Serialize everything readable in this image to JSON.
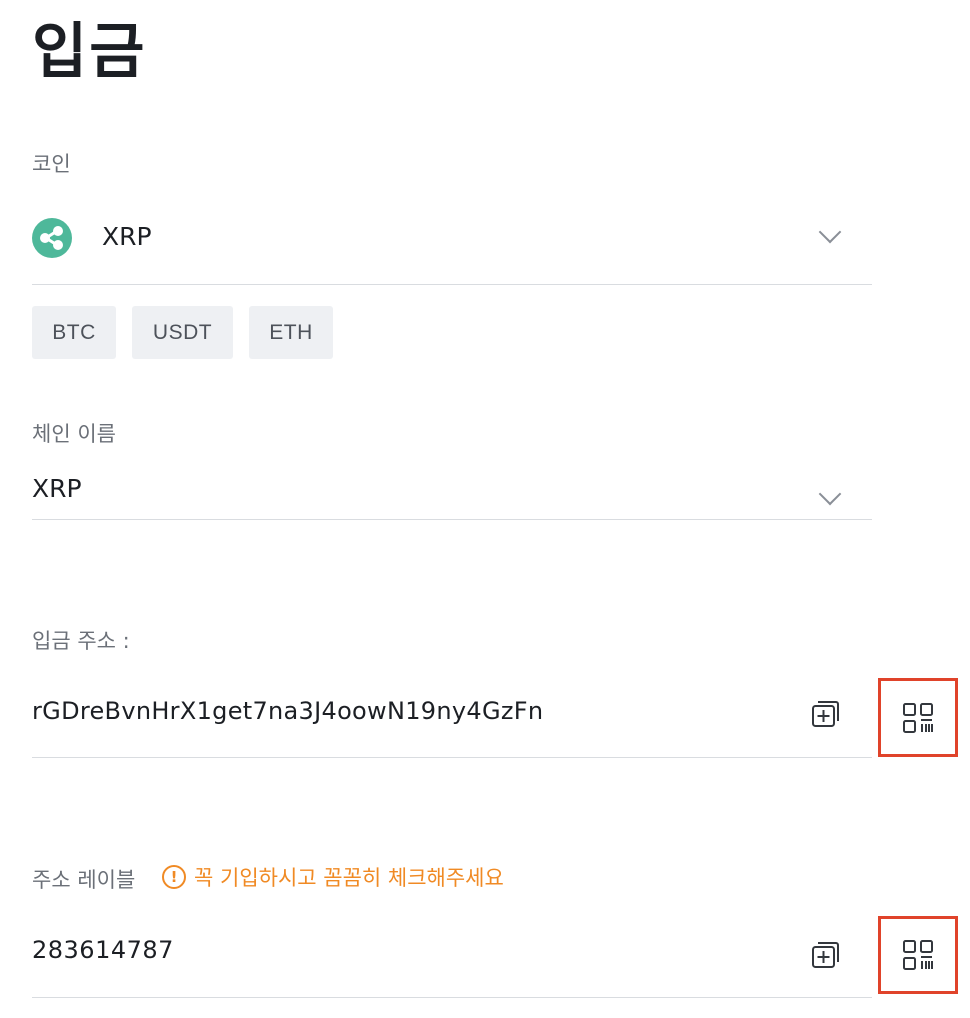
{
  "page": {
    "title": "입금"
  },
  "coin": {
    "label": "코인",
    "selected": "XRP",
    "logo": "xrp-logo",
    "logo_color": "#4eb89a",
    "quick_picks": [
      "BTC",
      "USDT",
      "ETH"
    ]
  },
  "chain": {
    "label": "체인 이름",
    "selected": "XRP"
  },
  "deposit_address": {
    "label": "입금 주소 :",
    "value": "rGDreBvnHrX1get7na3J4oowN19ny4GzFn",
    "copy_icon": "copy-icon",
    "qr_icon": "qr-code-icon"
  },
  "address_label": {
    "label": "주소 레이블",
    "warning": "꼭 기입하시고 꼼꼼히 체크해주세요",
    "warning_color": "#f08a24",
    "value": "283614787",
    "copy_icon": "copy-icon",
    "qr_icon": "qr-code-icon"
  },
  "highlight_color": "#e0432a"
}
